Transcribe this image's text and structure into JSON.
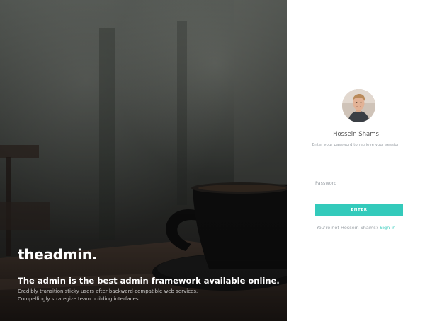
{
  "hero": {
    "brand": "theadmin.",
    "tagline": "The admin is the best admin framework available online.",
    "description": "Credibly transition sticky users after backward-compatible web services. Compellingly strategize team building interfaces."
  },
  "login": {
    "user_name": "Hossein Shams",
    "hint": "Enter your password to retrieve your session",
    "password_placeholder": "Password",
    "enter_label": "ENTER",
    "switch_prefix": "You're not Hossein Shams?",
    "signin_label": "Sign in"
  },
  "colors": {
    "accent": "#33cabb",
    "muted_text": "#9aa0a6"
  },
  "icons": {
    "avatar": "user-avatar-photo"
  }
}
